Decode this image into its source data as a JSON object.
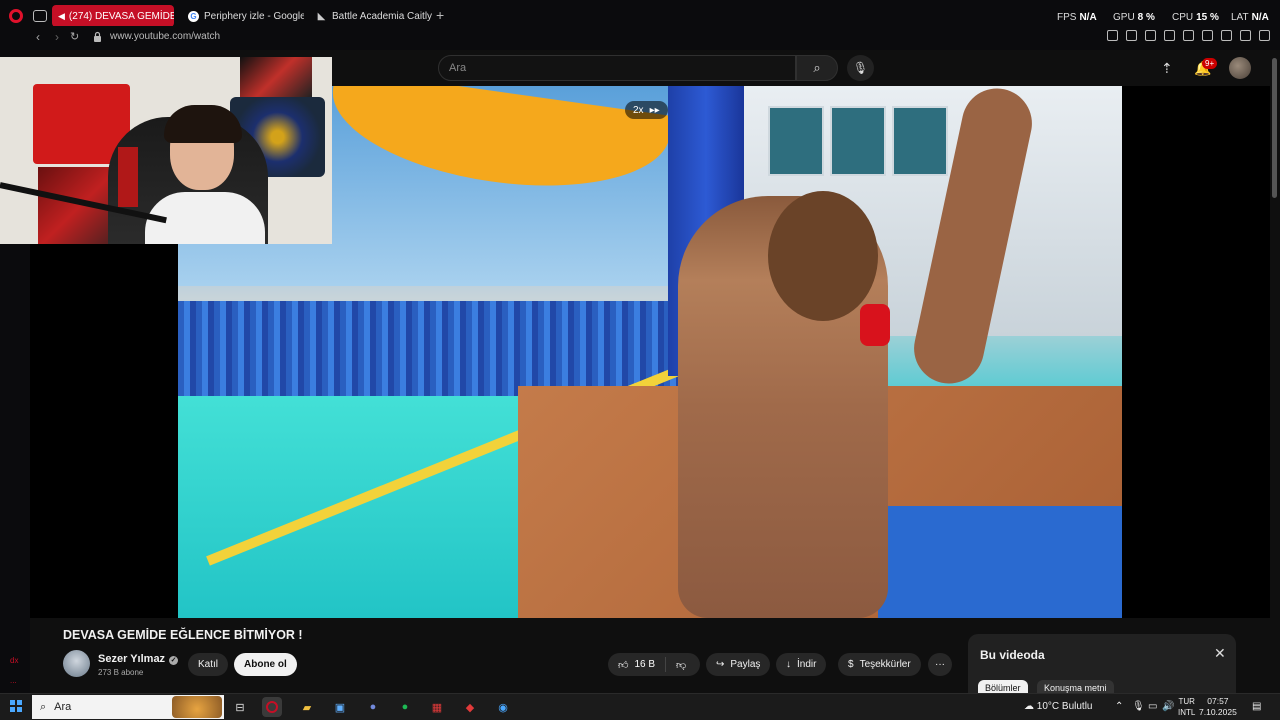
{
  "browser": {
    "tabs": [
      {
        "label": "(274) DEVASA GEMİDE",
        "active": true,
        "favicon": "youtube-icon"
      },
      {
        "label": "Periphery izle - Google'da",
        "active": false,
        "favicon": "google-icon"
      },
      {
        "label": "Battle Academia Caitlyn",
        "active": false,
        "favicon": "game-icon"
      }
    ],
    "new_tab_label": "+",
    "url": "www.youtube.com/watch",
    "accent": "#c50f26",
    "perf": {
      "fps_label": "FPS",
      "fps_value": "N/A",
      "gpu_label": "GPU",
      "gpu_value": "8 %",
      "cpu_label": "CPU",
      "cpu_value": "15 %",
      "lat_label": "LAT",
      "lat_value": "N/A"
    },
    "sidebar_texts": [
      "dx",
      "..."
    ]
  },
  "youtube": {
    "search_placeholder": "Ara",
    "notification_count": "9+",
    "player": {
      "speed_badge": "2x",
      "speed_icon": "fast-forward-icon"
    },
    "video": {
      "title": "DEVASA GEMİDE EĞLENCE BİTMİYOR !",
      "channel_name": "Sezer Yılmaz",
      "verified_mark": "✓",
      "subscribers": "273 B abone",
      "join_label": "Katıl",
      "subscribe_label": "Abone ol",
      "likes": "16 B",
      "share_label": "Paylaş",
      "download_label": "İndir",
      "thanks_label": "Teşekkürler",
      "more_label": "···"
    },
    "side_panel": {
      "title": "Bu videoda",
      "chips": [
        "Bölümler",
        "Konuşma metni"
      ]
    }
  },
  "taskbar": {
    "search_label": "Ara",
    "weather": "10°C  Bulutlu",
    "lang_top": "TUR",
    "lang_bottom": "INTL",
    "time": "07:57",
    "date": "7.10.2025"
  }
}
